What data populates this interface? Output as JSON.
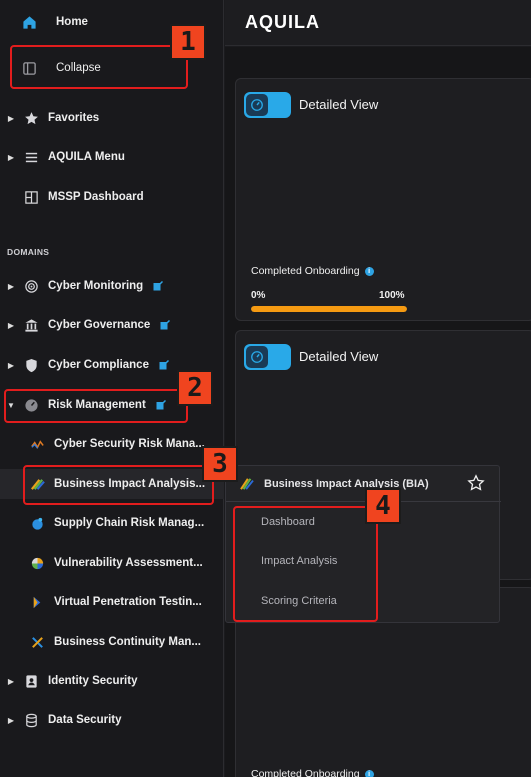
{
  "sidebar": {
    "home": "Home",
    "collapse": "Collapse",
    "favorites": "Favorites",
    "aquila_menu": "AQUILA Menu",
    "mssp_dashboard": "MSSP Dashboard",
    "domains_label": "DOMAINS",
    "cyber_monitoring": "Cyber Monitoring",
    "cyber_governance": "Cyber Governance",
    "cyber_compliance": "Cyber Compliance",
    "risk_management": "Risk Management",
    "risk_children": [
      "Cyber Security Risk Mana...",
      "Business Impact Analysis...",
      "Supply Chain Risk Manag...",
      "Vulnerability Assessment...",
      "Virtual Penetration Testin...",
      "Business Continuity Man..."
    ],
    "identity_security": "Identity Security",
    "data_security": "Data Security"
  },
  "header": {
    "logo": "AQUILA"
  },
  "cards": [
    {
      "title": "Detailed View",
      "onboarding_label": "Completed Onboarding",
      "min": "0%",
      "max": "100%",
      "progress": 1.0
    },
    {
      "title": "Detailed View",
      "onboarding_label": "Completed Onboarding"
    }
  ],
  "flyout": {
    "title": "Business Impact Analysis (BIA)",
    "items": [
      "Dashboard",
      "Impact Analysis",
      "Scoring Criteria"
    ]
  },
  "annotations": {
    "b1": "1",
    "b2": "2",
    "b3": "3",
    "b4": "4"
  },
  "colors": {
    "accent": "#29a9e8",
    "progress": "#f59a12",
    "annotation_border": "#e21d1d",
    "badge": "#f0441f"
  },
  "icons": {
    "home": "home-icon",
    "collapse": "panel-icon",
    "favorites": "star-icon",
    "menu": "hamburger-icon",
    "dashboard": "grid-icon",
    "monitoring": "target-icon",
    "governance": "bank-icon",
    "compliance": "shield-icon",
    "risk": "gauge-icon",
    "edit": "external-edit-icon",
    "identity": "id-badge-icon",
    "data": "database-icon"
  }
}
